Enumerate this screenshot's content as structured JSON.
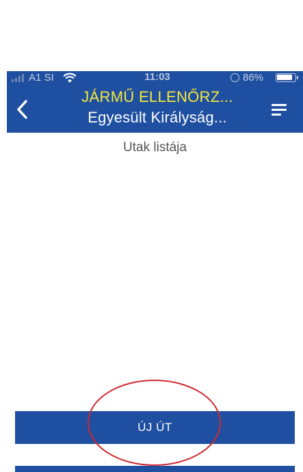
{
  "status_bar": {
    "carrier": "A1 SI",
    "time": "11:03",
    "battery": "86%",
    "battery_level": 0.86
  },
  "header": {
    "title": "JÁRMŰ ELLENŐRZ...",
    "subtitle": "Egyesült Királyság...",
    "title_color": "#f4e93c",
    "background_color": "#1f4fa0",
    "back_icon": "chevron-left-icon",
    "menu_icon": "menu-icon"
  },
  "main": {
    "heading": "Utak listája",
    "new_trip_button": "ÚJ ÚT"
  },
  "annotation": {
    "shape": "ellipse",
    "color": "#d0272f"
  }
}
